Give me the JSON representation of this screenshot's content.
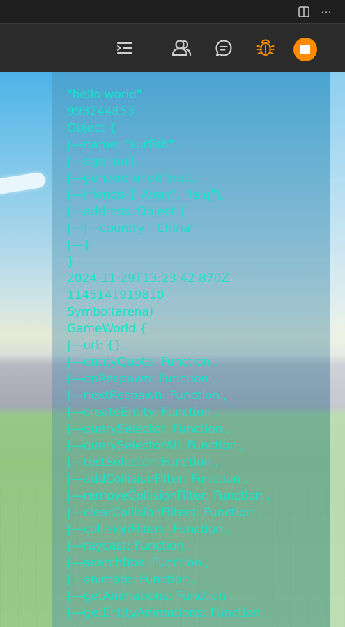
{
  "titlebar": {
    "layout_icon": "split-editor-icon",
    "more_icon": "more-icon",
    "more_label": "···"
  },
  "toolbar": {
    "tools": [
      {
        "name": "outline-indent-icon"
      },
      {
        "name": "users-icon"
      },
      {
        "name": "chat-icon"
      },
      {
        "name": "bug-icon"
      }
    ],
    "stop_icon": "stop-icon",
    "accent_color": "#ff8c00"
  },
  "console": {
    "text_color": "#18e3c8",
    "lines": [
      "\"hello world\"",
      "993244853",
      "Object {",
      "|---name: \"surfish\",",
      "|---age: null,",
      "|---gender: undefined,",
      "|---friends: [\"Alray\", \"laiq\"],",
      "|---address: Object {",
      "|---|---country: \"China\"",
      "|---}",
      "}",
      "2024-11-29T13:23:42.870Z",
      "1145141919810",
      "Symbol(arena)",
      "GameWorld {",
      "|---url: {},",
      "|---entityQuota: Function ,",
      "|---onRespawn: Function ,",
      "|---nextRespawn: Function ,",
      "|---createEntity: Function ,",
      "|---querySelector: Function ,",
      "|---querySelectorAll: Function ,",
      "|---testSelector: Function ,",
      "|---addCollisionFilter: Function ,",
      "|---removeCollisionFilter: Function ,",
      "|---clearCollisionFilters: Function ,",
      "|---collisionFilters: Function ,",
      "|---raycast: Function ,",
      "|---searchBox: Function ,",
      "|---animate: Function ,",
      "|---getAnimations: Function ,",
      "|---getEntityAnimations: Function ,"
    ]
  }
}
